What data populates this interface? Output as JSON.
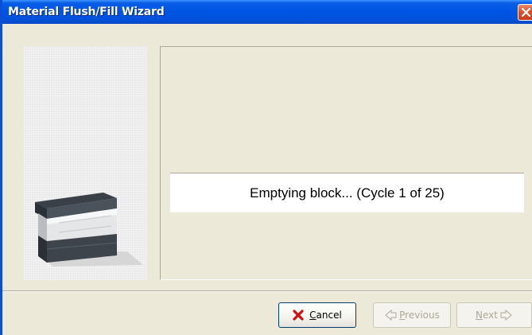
{
  "window": {
    "title": "Material Flush/Fill Wizard",
    "close_icon": "close-icon"
  },
  "status": {
    "message": "Emptying block... (Cycle 1 of 25)"
  },
  "buttons": {
    "cancel": {
      "mnemonic": "C",
      "rest": "ancel",
      "icon": "red-x-icon",
      "enabled": true
    },
    "previous": {
      "mnemonic": "P",
      "rest": "revious",
      "icon": "back-arrow-icon",
      "enabled": false
    },
    "next": {
      "mnemonic": "N",
      "rest": "ext",
      "icon": "forward-arrow-icon",
      "enabled": false
    }
  },
  "colors": {
    "titlebar": "#0055e5",
    "dialog_bg": "#ece9d8",
    "close_red": "#d9542a",
    "cancel_x_red": "#cc1111"
  }
}
